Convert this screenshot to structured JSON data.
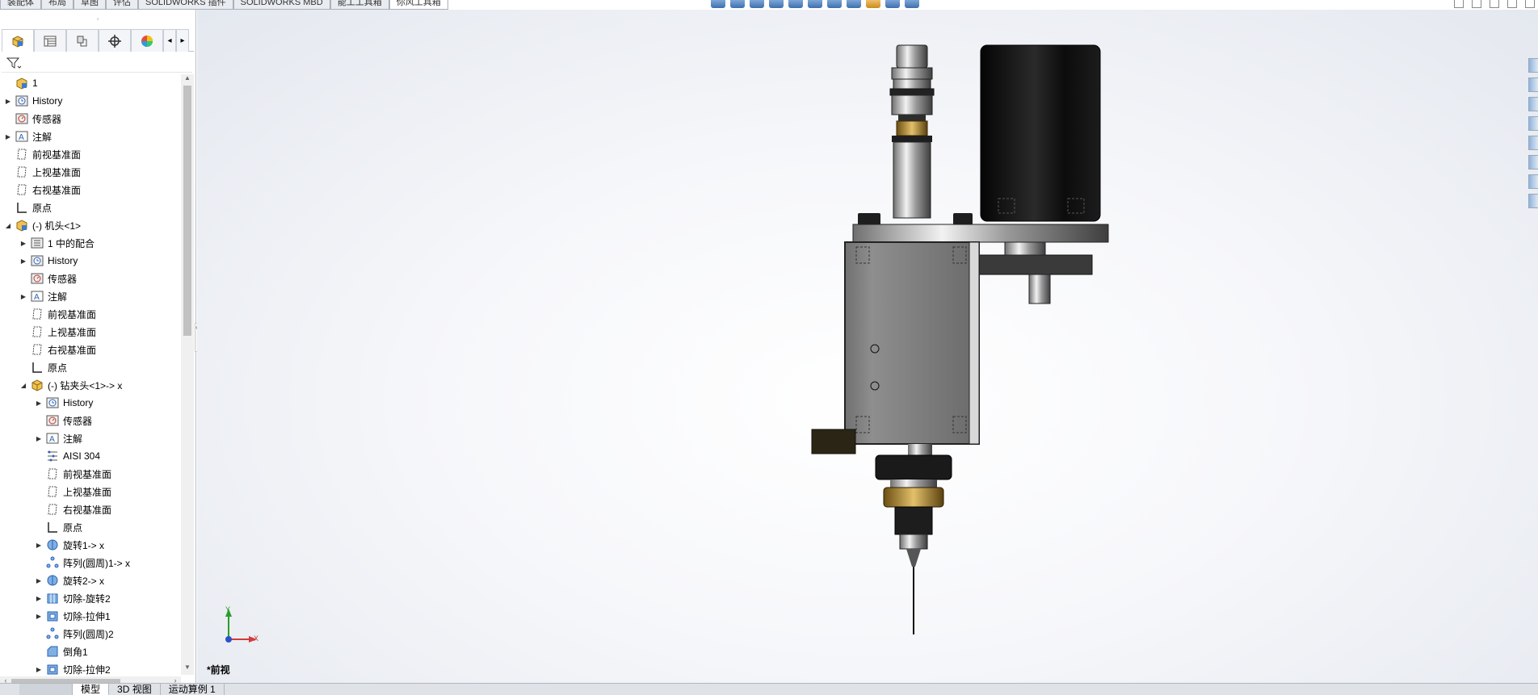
{
  "top_tabs": [
    "装配体",
    "布局",
    "草图",
    "评估",
    "SOLIDWORKS 插件",
    "SOLIDWORKS MBD",
    "能工工具箱",
    "你风工具箱"
  ],
  "top_tabs_active": 7,
  "manager_tabs": [
    "feature-manager",
    "property-manager",
    "configuration-manager",
    "dimxpert-manager",
    "display-manager"
  ],
  "tree": [
    {
      "label": "1",
      "level": 0,
      "arrow": "",
      "icon": "assembly"
    },
    {
      "label": "History",
      "level": 0,
      "arrow": "right",
      "icon": "history"
    },
    {
      "label": "传感器",
      "level": 0,
      "arrow": "",
      "icon": "sensor"
    },
    {
      "label": "注解",
      "level": 0,
      "arrow": "right",
      "icon": "annotation"
    },
    {
      "label": "前视基准面",
      "level": 0,
      "arrow": "",
      "icon": "plane"
    },
    {
      "label": "上视基准面",
      "level": 0,
      "arrow": "",
      "icon": "plane"
    },
    {
      "label": "右视基准面",
      "level": 0,
      "arrow": "",
      "icon": "plane"
    },
    {
      "label": "原点",
      "level": 0,
      "arrow": "",
      "icon": "origin"
    },
    {
      "label": "(-) 机头<1>",
      "level": 0,
      "arrow": "down",
      "icon": "assembly"
    },
    {
      "label": "1 中的配合",
      "level": 1,
      "arrow": "right",
      "icon": "mate"
    },
    {
      "label": "History",
      "level": 1,
      "arrow": "right",
      "icon": "history"
    },
    {
      "label": "传感器",
      "level": 1,
      "arrow": "",
      "icon": "sensor"
    },
    {
      "label": "注解",
      "level": 1,
      "arrow": "right",
      "icon": "annotation"
    },
    {
      "label": "前视基准面",
      "level": 1,
      "arrow": "",
      "icon": "plane"
    },
    {
      "label": "上视基准面",
      "level": 1,
      "arrow": "",
      "icon": "plane"
    },
    {
      "label": "右视基准面",
      "level": 1,
      "arrow": "",
      "icon": "plane"
    },
    {
      "label": "原点",
      "level": 1,
      "arrow": "",
      "icon": "origin"
    },
    {
      "label": "(-) 钻夹头<1>-> x",
      "level": 1,
      "arrow": "down",
      "icon": "part"
    },
    {
      "label": "History",
      "level": 2,
      "arrow": "right",
      "icon": "history"
    },
    {
      "label": "传感器",
      "level": 2,
      "arrow": "",
      "icon": "sensor"
    },
    {
      "label": "注解",
      "level": 2,
      "arrow": "right",
      "icon": "annotation"
    },
    {
      "label": "AISI 304",
      "level": 2,
      "arrow": "",
      "icon": "material"
    },
    {
      "label": "前视基准面",
      "level": 2,
      "arrow": "",
      "icon": "plane"
    },
    {
      "label": "上视基准面",
      "level": 2,
      "arrow": "",
      "icon": "plane"
    },
    {
      "label": "右视基准面",
      "level": 2,
      "arrow": "",
      "icon": "plane"
    },
    {
      "label": "原点",
      "level": 2,
      "arrow": "",
      "icon": "origin"
    },
    {
      "label": "旋转1-> x",
      "level": 2,
      "arrow": "right",
      "icon": "revolve"
    },
    {
      "label": "阵列(圆周)1-> x",
      "level": 2,
      "arrow": "",
      "icon": "pattern"
    },
    {
      "label": "旋转2-> x",
      "level": 2,
      "arrow": "right",
      "icon": "revolve"
    },
    {
      "label": "切除-旋转2",
      "level": 2,
      "arrow": "right",
      "icon": "cut-revolve"
    },
    {
      "label": "切除-拉伸1",
      "level": 2,
      "arrow": "right",
      "icon": "cut-extrude"
    },
    {
      "label": "阵列(圆周)2",
      "level": 2,
      "arrow": "",
      "icon": "pattern"
    },
    {
      "label": "倒角1",
      "level": 2,
      "arrow": "",
      "icon": "chamfer"
    },
    {
      "label": "切除-拉伸2",
      "level": 2,
      "arrow": "right",
      "icon": "cut-extrude"
    }
  ],
  "viewport": {
    "view_label": "*前视",
    "triad": {
      "y": "Y",
      "x": "X"
    }
  },
  "bottom_tabs": [
    "模型",
    "3D 视图",
    "运动算例 1"
  ],
  "bottom_tabs_active": 0,
  "colors": {
    "accent": "#2a62b8",
    "panel_border": "#b9c0c8",
    "tab_bg": "#e9ecf0"
  }
}
